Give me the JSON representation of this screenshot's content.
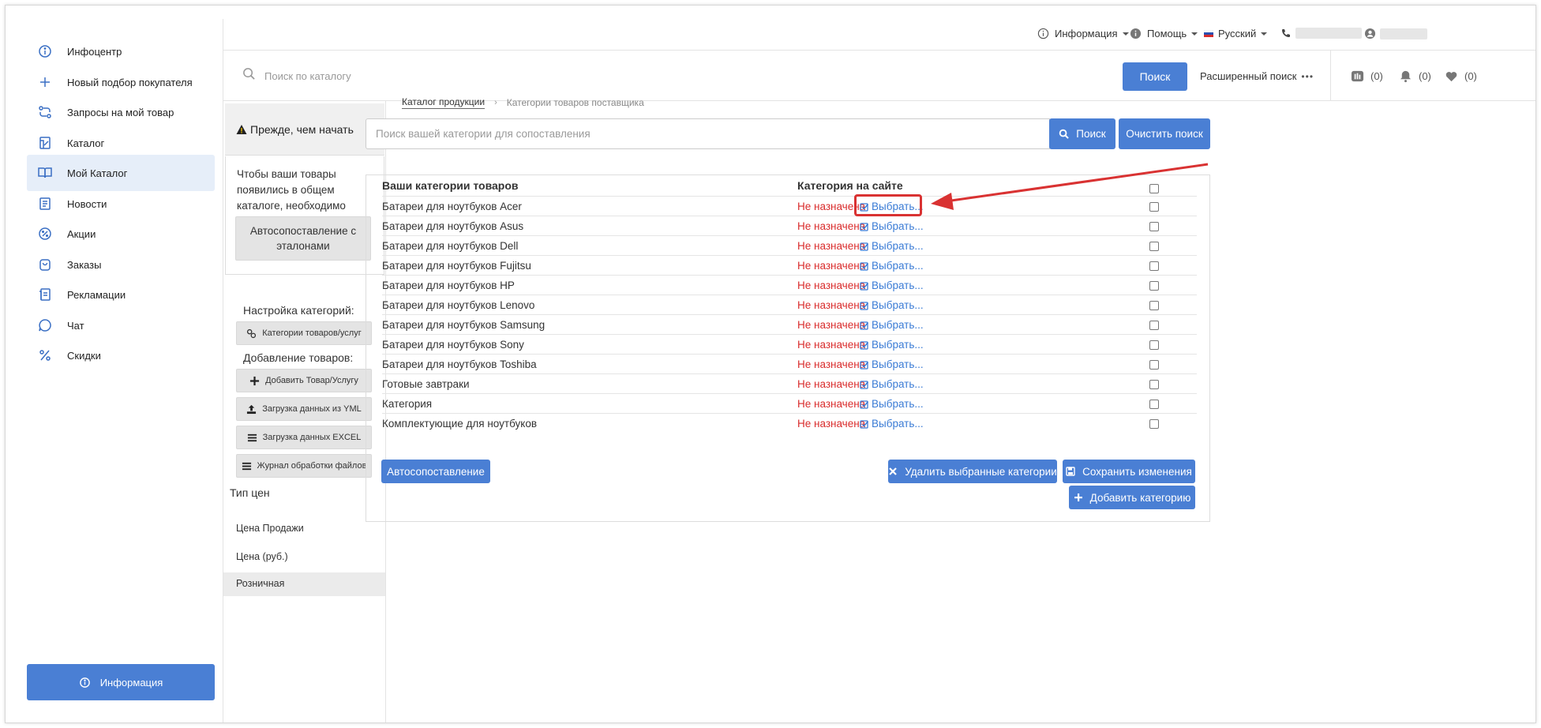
{
  "sidebar": {
    "items": [
      {
        "label": "Инфоцентр",
        "icon": "info-circle-icon"
      },
      {
        "label": "Новый подбор покупателя",
        "icon": "plus-icon"
      },
      {
        "label": "Запросы на мой товар",
        "icon": "exchange-icon"
      },
      {
        "label": "Каталог",
        "icon": "catalog-icon"
      },
      {
        "label": "Мой Каталог",
        "icon": "open-book-icon"
      },
      {
        "label": "Новости",
        "icon": "news-icon"
      },
      {
        "label": "Акции",
        "icon": "percent-badge-icon"
      },
      {
        "label": "Заказы",
        "icon": "shopping-bag-icon"
      },
      {
        "label": "Рекламации",
        "icon": "complaint-icon"
      },
      {
        "label": "Чат",
        "icon": "chat-icon"
      },
      {
        "label": "Скидки",
        "icon": "percent-icon"
      }
    ],
    "active_index": 4,
    "info_button": "Информация"
  },
  "topbar": {
    "info": "Информация",
    "help": "Помощь",
    "language": "Русский"
  },
  "search": {
    "placeholder": "Поиск по каталогу",
    "button": "Поиск",
    "advanced": "Расширенный поиск",
    "counters": [
      "(0)",
      "(0)",
      "(0)"
    ]
  },
  "left_panel": {
    "warning_title": "Прежде, чем начать",
    "intro_text": "Чтобы ваши товары появились в общем каталоге, необходимо сопоставить их с эталонами.",
    "automatch_button": "Автосопоставление с эталонами",
    "settings_title": "Настройка категорий:",
    "categories_button": "Категории товаров/услуг",
    "add_title": "Добавление товаров:",
    "add_product_button": "Добавить Товар/Услугу",
    "yml_button": "Загрузка данных из YML",
    "excel_button": "Загрузка данных EXCEL",
    "log_button": "Журнал обработки файлов",
    "price_type_title": "Тип цен",
    "price_items": [
      "Цена Продажи",
      "Цена (руб.)",
      "Розничная"
    ]
  },
  "main": {
    "breadcrumb": {
      "link": "Каталог продукции",
      "current": "Категории товаров поставщика"
    },
    "category_search_placeholder": "Поиск вашей категории для сопоставления",
    "search_button": "Поиск",
    "clear_button": "Очистить поиск",
    "table": {
      "col_yours": "Ваши категории товаров",
      "col_site": "Категория на сайте",
      "status_text": "Не назначена",
      "choose_text": "Выбрать...",
      "rows": [
        "Батареи для ноутбуков Acer",
        "Батареи для ноутбуков Asus",
        "Батареи для ноутбуков Dell",
        "Батареи для ноутбуков Fujitsu",
        "Батареи для ноутбуков HP",
        "Батареи для ноутбуков Lenovo",
        "Батареи для ноутбуков Samsung",
        "Батареи для ноутбуков Sony",
        "Батареи для ноутбуков Toshiba",
        "Готовые завтраки",
        "Категория",
        "Комплектующие для ноутбуков"
      ]
    },
    "automatch_button": "Автосопоставление",
    "delete_button": "Удалить выбранные категории",
    "save_button": "Сохранить изменения",
    "add_category_button": "Добавить категорию"
  },
  "colors": {
    "primary": "#4a7fd4",
    "status_red": "#d92b2b",
    "link_blue": "#3a7bd5",
    "annotation_red": "#d93232"
  }
}
